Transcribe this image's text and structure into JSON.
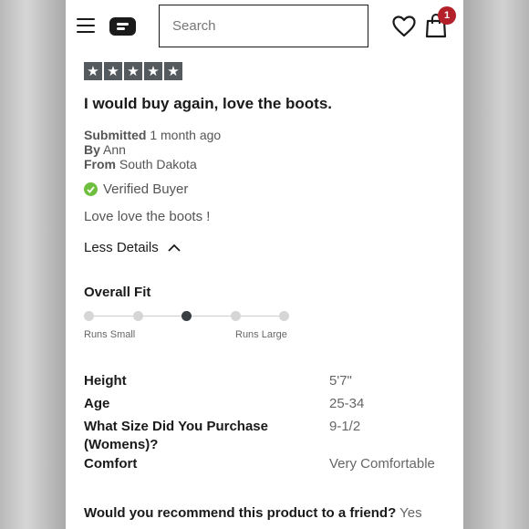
{
  "header": {
    "search_placeholder": "Search",
    "cart_count": "1",
    "icons": [
      "hamburger-menu-icon",
      "brand-logo-icon",
      "heart-icon",
      "shopping-bag-icon"
    ]
  },
  "review": {
    "rating": 5,
    "rating_max": 5,
    "star_glyph": "★",
    "title": "I would buy again, love the boots.",
    "submitted_label": "Submitted",
    "submitted_value": "1 month ago",
    "by_label": "By",
    "by_value": "Ann",
    "from_label": "From",
    "from_value": "South Dakota",
    "verified_text": "Verified Buyer",
    "body": "Love love the boots !",
    "less_details": "Less Details"
  },
  "overall_fit": {
    "title": "Overall Fit",
    "steps": 5,
    "selected_index": 2,
    "min_label": "Runs Small",
    "max_label": "Runs Large"
  },
  "attributes": [
    {
      "label": "Height",
      "value": "5'7\""
    },
    {
      "label": "Age",
      "value": "25-34"
    },
    {
      "label": "What Size Did You Purchase (Womens)?",
      "value": "9-1/2"
    },
    {
      "label": "Comfort",
      "value": "Very Comfortable"
    }
  ],
  "recommend": {
    "question": "Would you recommend this product to a friend?",
    "answer": "Yes"
  },
  "colors": {
    "star_bg": "#555a5f",
    "verified_green": "#6fbf3f",
    "badge_red": "#b3202a"
  }
}
